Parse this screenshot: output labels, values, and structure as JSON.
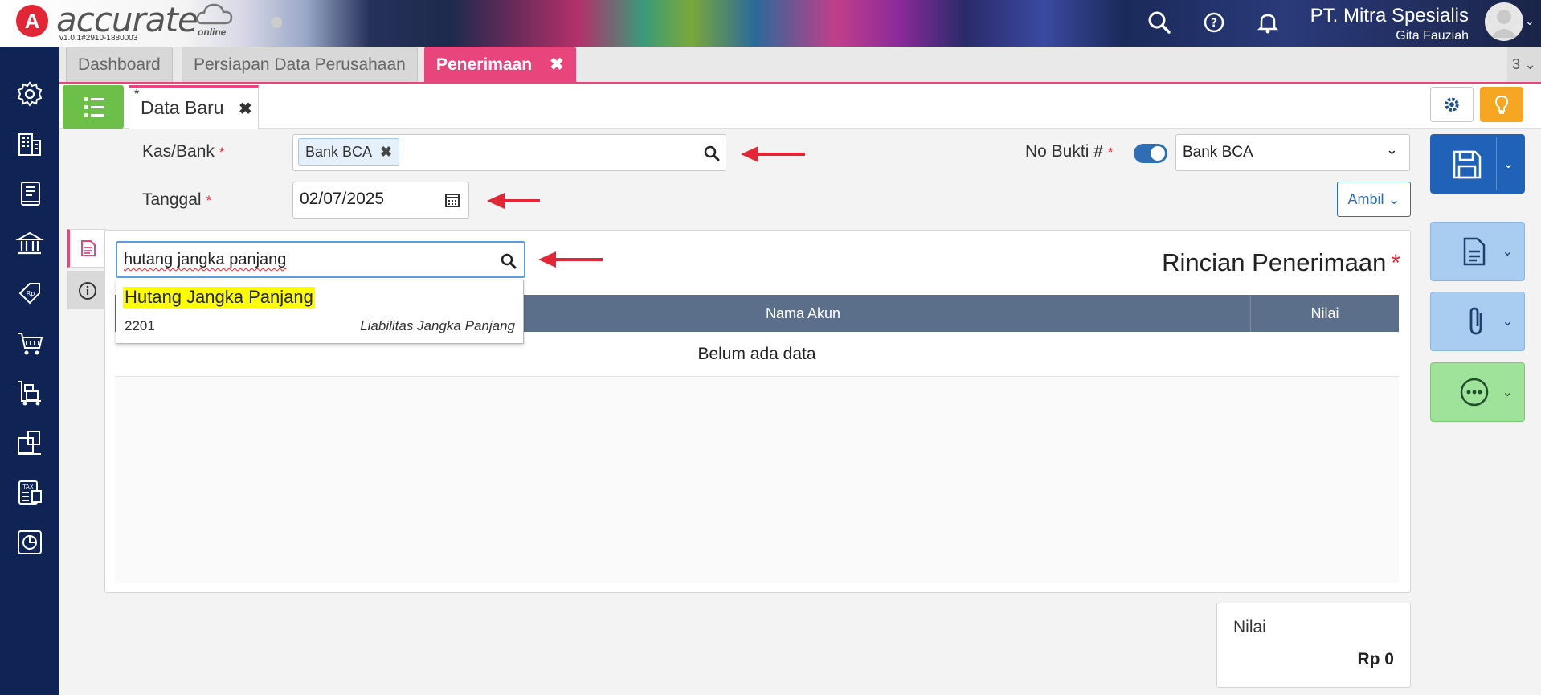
{
  "header": {
    "brand": "accurate",
    "brand_sub": "online",
    "version": "v1.0.1#2910-1880003",
    "company": "PT. Mitra Spesialis",
    "user": "Gita Fauziah",
    "icons": [
      "search-icon",
      "help-icon",
      "bell-icon",
      "avatar"
    ]
  },
  "sidebar": {
    "items": [
      "settings-icon",
      "company-icon",
      "ledger-icon",
      "bank-icon",
      "sales-icon",
      "cart-icon",
      "warehouse-icon",
      "inventory-icon",
      "tax-icon",
      "report-icon"
    ]
  },
  "tabs": [
    {
      "label": "Dashboard"
    },
    {
      "label": "Persiapan Data Perusahaan"
    },
    {
      "label": "Penerimaan",
      "close": "✖"
    }
  ],
  "tab_count": "3",
  "doc_tab": {
    "asterisk": "*",
    "label": "Data Baru",
    "close": "✖"
  },
  "form": {
    "kas_label": "Kas/Bank",
    "kas_value": "Bank BCA",
    "tanggal_label": "Tanggal",
    "tanggal_value": "02/07/2025",
    "no_bukti_label": "No Bukti #",
    "no_bukti_value": "Bank BCA",
    "ambil_label": "Ambil",
    "required_mark": "*"
  },
  "panel": {
    "title": "Rincian Penerimaan",
    "columns": [
      "Nama Akun",
      "Nilai"
    ],
    "empty_text": "Belum ada data"
  },
  "search": {
    "value": "hutang jangka panjang",
    "results": [
      {
        "name": "Hutang Jangka Panjang",
        "code": "2201",
        "type": "Liabilitas Jangka Panjang"
      }
    ]
  },
  "summary": {
    "label": "Nilai",
    "value": "Rp 0"
  },
  "colors": {
    "accent": "#e8457c",
    "primary": "#2f6db5",
    "sidebar": "#0f2454",
    "success": "#6cc04a",
    "warning": "#f5a623",
    "table_header": "#5c6f8a"
  }
}
